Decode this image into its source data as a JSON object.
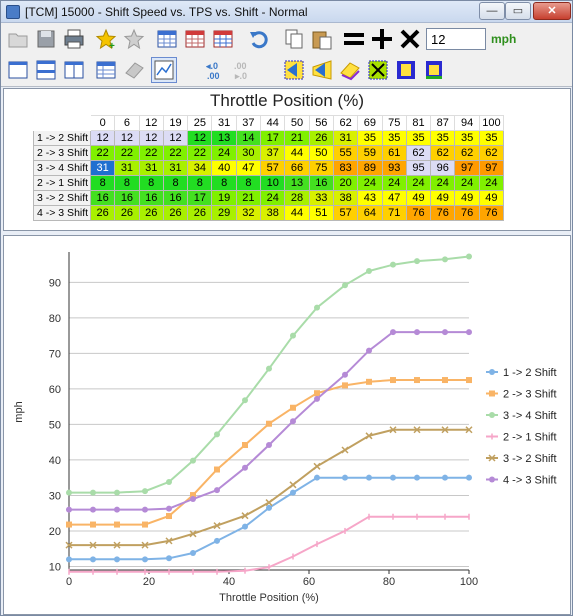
{
  "window": {
    "title": "[TCM] 15000 - Shift Speed vs. TPS vs. Shift - Normal",
    "min_label": "—",
    "max_label": "▭",
    "close_label": "✕"
  },
  "toolbar": {
    "tps_value": "12",
    "unit": "mph"
  },
  "table": {
    "title": "Throttle Position (%)",
    "columns": [
      "0",
      "6",
      "12",
      "19",
      "25",
      "31",
      "37",
      "44",
      "50",
      "56",
      "62",
      "69",
      "75",
      "81",
      "87",
      "94",
      "100"
    ],
    "rows": [
      {
        "label": "1 -> 2 Shift",
        "values": [
          "12",
          "12",
          "12",
          "12",
          "12",
          "13",
          "14",
          "17",
          "21",
          "26",
          "31",
          "35",
          "35",
          "35",
          "35",
          "35",
          "35"
        ]
      },
      {
        "label": "2 -> 3 Shift",
        "values": [
          "22",
          "22",
          "22",
          "22",
          "22",
          "24",
          "30",
          "37",
          "44",
          "50",
          "55",
          "59",
          "61",
          "62",
          "62",
          "62",
          "62"
        ]
      },
      {
        "label": "3 -> 4 Shift",
        "values": [
          "31",
          "31",
          "31",
          "31",
          "34",
          "40",
          "47",
          "57",
          "66",
          "75",
          "83",
          "89",
          "93",
          "95",
          "96",
          "97",
          "97"
        ]
      },
      {
        "label": "2 -> 1 Shift",
        "values": [
          "8",
          "8",
          "8",
          "8",
          "8",
          "8",
          "8",
          "10",
          "13",
          "16",
          "20",
          "24",
          "24",
          "24",
          "24",
          "24",
          "24"
        ]
      },
      {
        "label": "3 -> 2 Shift",
        "values": [
          "16",
          "16",
          "16",
          "16",
          "17",
          "19",
          "21",
          "24",
          "28",
          "33",
          "38",
          "43",
          "47",
          "49",
          "49",
          "49",
          "49"
        ]
      },
      {
        "label": "4 -> 3 Shift",
        "values": [
          "26",
          "26",
          "26",
          "26",
          "26",
          "29",
          "32",
          "38",
          "44",
          "51",
          "57",
          "64",
          "71",
          "76",
          "76",
          "76",
          "76"
        ]
      }
    ],
    "cell_colors": {
      "lavender": "#dcdcf5",
      "lime": "#80f000",
      "green": "#22dd22",
      "light_green": "#a8f000",
      "yellow_green": "#d8f000",
      "yellow": "#ffff00",
      "light_orange": "#ffd000",
      "orange": "#ffa500",
      "selected": "#1f6fd0"
    }
  },
  "chart_data": {
    "type": "line",
    "xlabel": "Throttle Position (%)",
    "ylabel": "mph",
    "xlim": [
      0,
      100
    ],
    "ylim": [
      9,
      98
    ],
    "xticks": [
      0,
      20,
      40,
      60,
      80,
      100
    ],
    "yticks": [
      10,
      20,
      30,
      40,
      50,
      60,
      70,
      80,
      90
    ],
    "grid": "horizontal",
    "legend_position": "right",
    "x": [
      0,
      6,
      12,
      19,
      25,
      31,
      37,
      44,
      50,
      56,
      62,
      69,
      75,
      81,
      87,
      94,
      100
    ],
    "series": [
      {
        "name": "1 -> 2 Shift",
        "color": "#7fb3e6",
        "marker": "circle",
        "values": [
          12,
          12,
          12,
          12,
          12.3,
          13.8,
          17.2,
          21.2,
          26.5,
          30.8,
          35,
          35,
          35,
          35,
          35,
          35,
          35
        ]
      },
      {
        "name": "2 -> 3 Shift",
        "color": "#f9b466",
        "marker": "square",
        "values": [
          21.8,
          21.8,
          21.8,
          21.8,
          24.2,
          30.1,
          37.3,
          44.2,
          50.2,
          54.7,
          58.8,
          61,
          62,
          62.5,
          62.5,
          62.5,
          62.5
        ]
      },
      {
        "name": "3 -> 4 Shift",
        "color": "#a9dca9",
        "marker": "circle",
        "values": [
          30.8,
          30.8,
          30.8,
          31.2,
          33.8,
          39.8,
          47.2,
          56.8,
          65.7,
          75,
          82.9,
          89.2,
          93.2,
          95,
          96,
          96.5,
          97.3
        ]
      },
      {
        "name": "2 -> 1 Shift",
        "color": "#f6a6c8",
        "marker": "dash",
        "values": [
          8.5,
          8.5,
          8.5,
          8.5,
          8.5,
          8.5,
          8.5,
          8.8,
          9.8,
          12.8,
          16.3,
          20,
          24,
          24,
          24,
          24,
          24
        ]
      },
      {
        "name": "3 -> 2 Shift",
        "color": "#c0a060",
        "marker": "x",
        "values": [
          16,
          16,
          16,
          16,
          17.2,
          19.2,
          21.5,
          24.3,
          28,
          33,
          38.2,
          42.8,
          46.8,
          48.5,
          48.5,
          48.5,
          48.5
        ]
      },
      {
        "name": "4 -> 3 Shift",
        "color": "#b58ad6",
        "marker": "circle",
        "values": [
          26,
          26,
          26,
          26,
          26.3,
          29,
          31.5,
          37.8,
          44.2,
          50.9,
          57.2,
          64,
          70.8,
          76,
          76,
          76,
          76
        ]
      }
    ]
  }
}
